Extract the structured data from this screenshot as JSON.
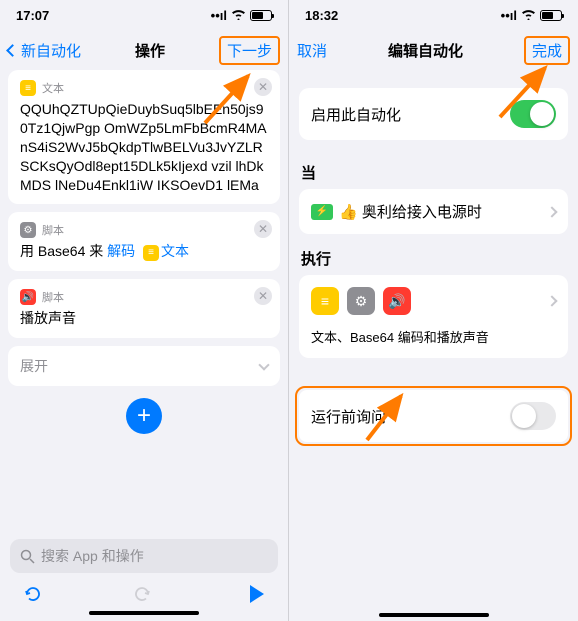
{
  "left": {
    "status_time": "17:07",
    "nav_back": "新自动化",
    "nav_title": "操作",
    "nav_next": "下一步",
    "card1": {
      "tag": "文本",
      "body": "QQUhQZTUpQieDuybSuq5lbEEn50js90Tz1QjwPgp\nOmWZp5LmFbBcmR4MAnS4iS2WvJ5bQkdpTlwBELVu3JvYZLRSCKsQyOdl8ept15DLk5kIjexd\nvzil lhDkMDS lNeDu4Enkl1iW IKSOevD1 lEMa"
    },
    "card2": {
      "tag": "脚本",
      "prefix": "用 Base64 来",
      "link": "解码",
      "suffix_tag": "文本"
    },
    "card3": {
      "tag": "脚本",
      "body": "播放声音"
    },
    "expand": "展开",
    "search_placeholder": "搜索 App 和操作"
  },
  "right": {
    "status_time": "18:32",
    "nav_cancel": "取消",
    "nav_title": "编辑自动化",
    "nav_done": "完成",
    "enable_label": "启用此自动化",
    "when_title": "当",
    "when_row": "👍 奥利给接入电源时",
    "do_title": "执行",
    "do_desc": "文本、Base64 编码和播放声音",
    "ask_label": "运行前询问"
  }
}
